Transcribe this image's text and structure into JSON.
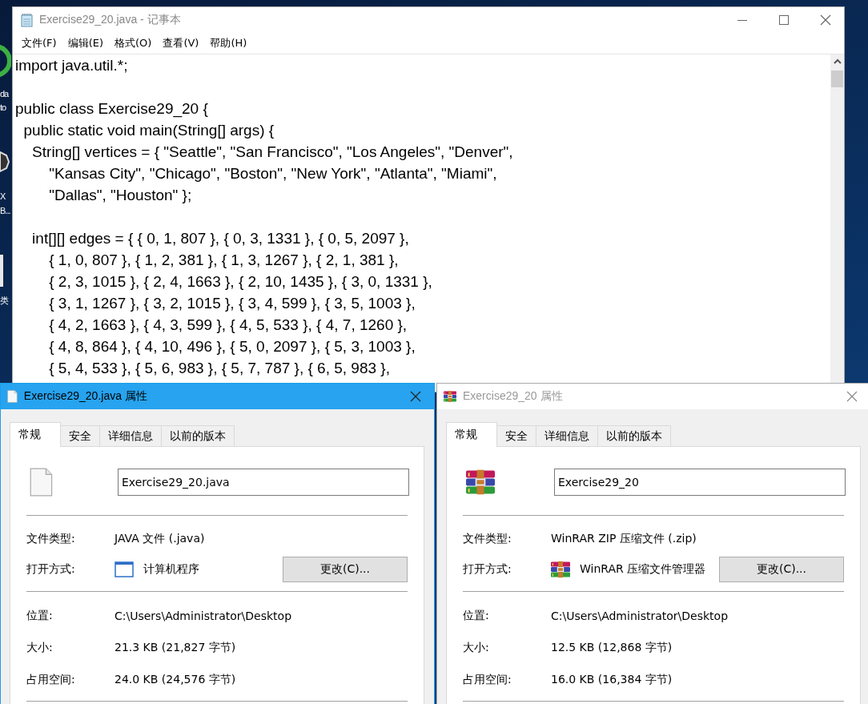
{
  "desktop": {
    "icon_labels": [
      {
        "text": "da"
      },
      {
        "text": "to"
      },
      {
        "text": "X"
      },
      {
        "text": "B..."
      },
      {
        "text": "类"
      }
    ]
  },
  "notepad": {
    "title": "Exercise29_20.java - 记事本",
    "menu": [
      "文件(F)",
      "编辑(E)",
      "格式(O)",
      "查看(V)",
      "帮助(H)"
    ],
    "code_blocks": [
      [
        "import java.util.*;"
      ],
      [
        "public class Exercise29_20 {",
        "  public static void main(String[] args) {",
        "    String[] vertices = { \"Seattle\", \"San Francisco\", \"Los Angeles\", \"Denver\",",
        "        \"Kansas City\", \"Chicago\", \"Boston\", \"New York\", \"Atlanta\", \"Miami\",",
        "        \"Dallas\", \"Houston\" };"
      ],
      [
        "    int[][] edges = { { 0, 1, 807 }, { 0, 3, 1331 }, { 0, 5, 2097 },",
        "        { 1, 0, 807 }, { 1, 2, 381 }, { 1, 3, 1267 }, { 2, 1, 381 },",
        "        { 2, 3, 1015 }, { 2, 4, 1663 }, { 2, 10, 1435 }, { 3, 0, 1331 },",
        "        { 3, 1, 1267 }, { 3, 2, 1015 }, { 3, 4, 599 }, { 3, 5, 1003 },",
        "        { 4, 2, 1663 }, { 4, 3, 599 }, { 4, 5, 533 }, { 4, 7, 1260 },",
        "        { 4, 8, 864 }, { 4, 10, 496 }, { 5, 0, 2097 }, { 5, 3, 1003 },",
        "        { 5, 4, 533 }, { 5, 6, 983 }, { 5, 7, 787 }, { 6, 5, 983 },"
      ]
    ]
  },
  "dialogs": [
    {
      "title": "Exercise29_20.java 属性",
      "kind": "file",
      "active": true,
      "tabs": [
        {
          "label": "常规",
          "selected": true
        },
        {
          "label": "安全",
          "selected": false
        },
        {
          "label": "详细信息",
          "selected": false
        },
        {
          "label": "以前的版本",
          "selected": false
        }
      ],
      "name": "Exercise29_20.java",
      "file_type": {
        "label": "文件类型:",
        "value": "JAVA 文件 (.java)"
      },
      "opens_with": {
        "label": "打开方式:",
        "app": "计算机程序",
        "kind": "window",
        "button": "更改(C)..."
      },
      "details": [
        {
          "label": "位置:",
          "value": "C:\\Users\\Administrator\\Desktop"
        },
        {
          "label": "大小:",
          "value": "21.3 KB (21,827 字节)"
        },
        {
          "label": "占用空间:",
          "value": "24.0 KB (24,576 字节)"
        }
      ]
    },
    {
      "title": "Exercise29_20 属性",
      "kind": "archive",
      "active": false,
      "tabs": [
        {
          "label": "常规",
          "selected": true
        },
        {
          "label": "安全",
          "selected": false
        },
        {
          "label": "详细信息",
          "selected": false
        },
        {
          "label": "以前的版本",
          "selected": false
        }
      ],
      "name": "Exercise29_20",
      "file_type": {
        "label": "文件类型:",
        "value": "WinRAR ZIP 压缩文件 (.zip)"
      },
      "opens_with": {
        "label": "打开方式:",
        "app": "WinRAR 压缩文件管理器",
        "kind": "archive",
        "button": "更改(C)..."
      },
      "details": [
        {
          "label": "位置:",
          "value": "C:\\Users\\Administrator\\Desktop"
        },
        {
          "label": "大小:",
          "value": "12.5 KB (12,868 字节)"
        },
        {
          "label": "占用空间:",
          "value": "16.0 KB (16,384 字节)"
        }
      ]
    }
  ]
}
